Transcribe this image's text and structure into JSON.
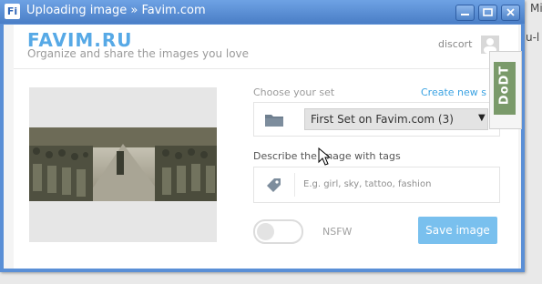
{
  "background": {
    "texts": [
      "Mid",
      "u-l"
    ]
  },
  "window": {
    "app_icon": "Fi",
    "title": "Uploading image » Favim.com",
    "buttons": [
      "minimize-icon",
      "maximize-icon",
      "close-icon"
    ]
  },
  "header": {
    "logo": "FAVIM.RU",
    "tagline": "Organize and share the images you love",
    "username": "discort"
  },
  "form": {
    "choose_set_label": "Choose your set",
    "create_new_label": "Create new s",
    "selected_set": "First Set on Favim.com (3)",
    "tags_label": "Describe the image with tags",
    "tags_placeholder": "E.g. girl, sky, tattoo, fashion",
    "nsfw_label": "NSFW",
    "nsfw_enabled": false,
    "save_label": "Save image"
  },
  "extension": {
    "label": "DoDT"
  },
  "colors": {
    "accent": "#3aa2e2",
    "save_button": "#79c0ee",
    "titlebar": "#4a7ec6"
  }
}
